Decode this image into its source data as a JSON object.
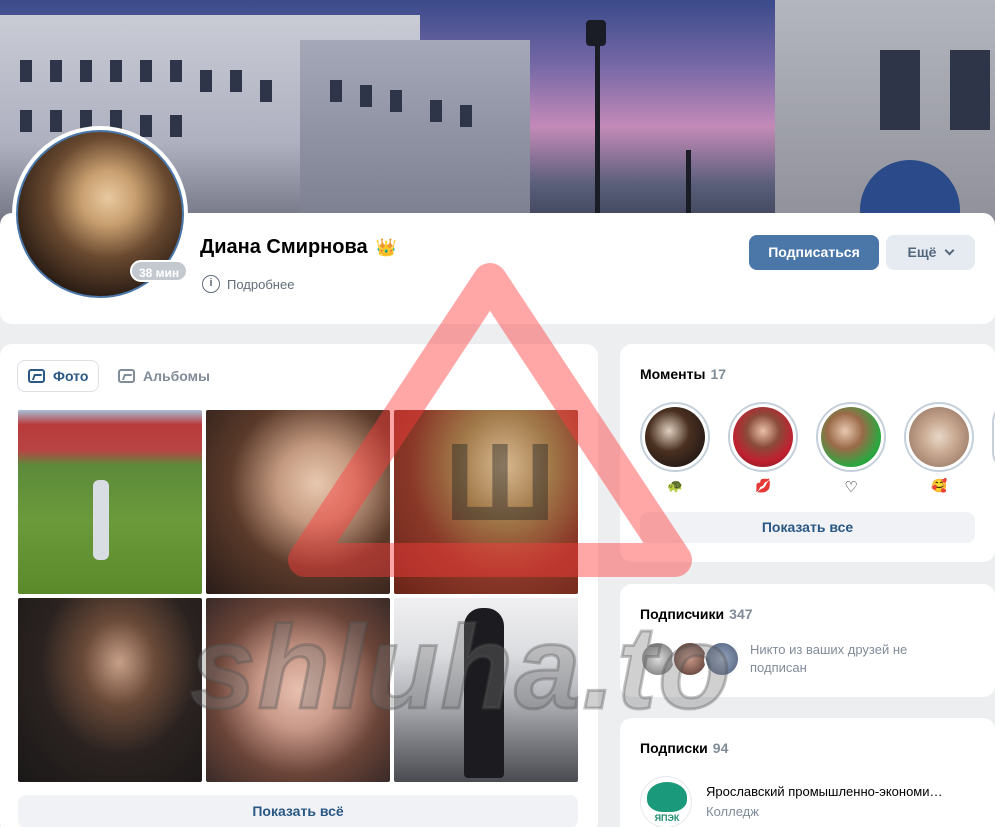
{
  "profile": {
    "name": "Диана Смирнова",
    "online": "38 мин",
    "more_info": "Подробнее",
    "subscribe_label": "Подписаться",
    "more_label": "Ещё"
  },
  "photos": {
    "tab_photos": "Фото",
    "tab_albums": "Альбомы",
    "show_all": "Показать всё"
  },
  "moments": {
    "title": "Моменты",
    "count": "17",
    "emojis": [
      "🐢",
      "💋",
      "♡",
      "🥰"
    ],
    "show_all": "Показать все"
  },
  "followers": {
    "title": "Подписчики",
    "count": "347",
    "note": "Никто из ваших друзей не подписан"
  },
  "subscriptions": {
    "title": "Подписки",
    "count": "94",
    "item_logo_text": "ЯПЭК",
    "item_name": "Ярославский промышленно-экономи…",
    "item_type": "Колледж"
  },
  "watermark": {
    "text": "shluha.to",
    "letter": "Ш"
  },
  "colors": {
    "accent": "#4a76a8",
    "link": "#2a5885",
    "secondary_text": "#818c99",
    "background": "#edeef0",
    "watermark_red": "#ff3030"
  }
}
